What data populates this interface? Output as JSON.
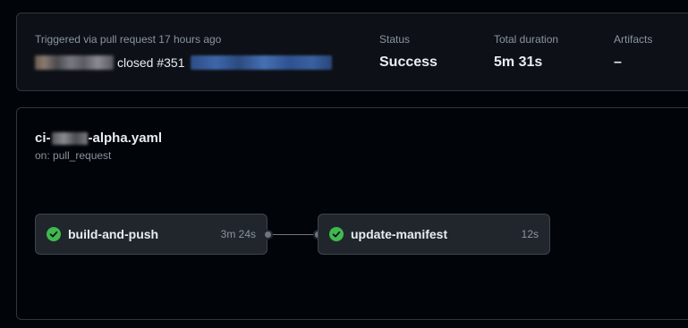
{
  "summary": {
    "trigger_label": "Triggered via pull request 17 hours ago",
    "trigger_action": "closed #351",
    "status_label": "Status",
    "status_value": "Success",
    "duration_label": "Total duration",
    "duration_value": "5m 31s",
    "artifacts_label": "Artifacts",
    "artifacts_value": "–"
  },
  "workflow": {
    "name_prefix": "ci-",
    "name_suffix": "-alpha.yaml",
    "trigger": "on: pull_request"
  },
  "jobs": [
    {
      "name": "build-and-push",
      "duration": "3m 24s",
      "status": "success"
    },
    {
      "name": "update-manifest",
      "duration": "12s",
      "status": "success"
    }
  ],
  "colors": {
    "success": "#3fb950",
    "border": "#30363d",
    "muted_text": "#8b949e"
  },
  "icons": {
    "job_status": "check-circle-fill-icon"
  }
}
